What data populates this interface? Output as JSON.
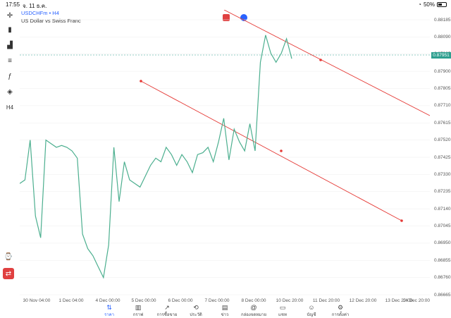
{
  "status": {
    "time": "17:55",
    "date": "จ. 11 ธ.ค.",
    "battery": "50%"
  },
  "symbol": {
    "name": "USDCHFm • H4",
    "description": "US Dollar vs Swiss Franc"
  },
  "price_axis": [
    "0.88185",
    "0.88090",
    "0.87995",
    "0.87900",
    "0.87805",
    "0.87710",
    "0.87615",
    "0.87520",
    "0.87425",
    "0.87330",
    "0.87235",
    "0.87140",
    "0.87045",
    "0.86950",
    "0.86855",
    "0.86760",
    "0.86665"
  ],
  "current_price": "0.87951",
  "time_axis": [
    "30 Nov 04:00",
    "1 Dec 04:00",
    "4 Dec 00:00",
    "5 Dec 00:00",
    "6 Dec 00:00",
    "7 Dec 00:00",
    "8 Dec 00:00",
    "10 Dec 20:00",
    "11 Dec 20:00",
    "12 Dec 20:00",
    "13 Dec 20:00",
    "14 Dec 20:00"
  ],
  "nav": [
    {
      "label": "ราคา",
      "icon": "quotes-icon",
      "glyph": "⇅",
      "active": true
    },
    {
      "label": "กราฟ",
      "icon": "chart-icon",
      "glyph": "▥",
      "active": false
    },
    {
      "label": "การซื้อขาย",
      "icon": "trade-icon",
      "glyph": "↗",
      "active": false
    },
    {
      "label": "ประวัติ",
      "icon": "history-icon",
      "glyph": "⟲",
      "active": false
    },
    {
      "label": "ข่าว",
      "icon": "news-icon",
      "glyph": "▤",
      "active": false
    },
    {
      "label": "กล่องจดหมาย",
      "icon": "mailbox-icon",
      "glyph": "@",
      "active": false
    },
    {
      "label": "แชท",
      "icon": "chat-icon",
      "glyph": "▭",
      "active": false
    },
    {
      "label": "บัญชี",
      "icon": "account-icon",
      "glyph": "☺",
      "active": false
    },
    {
      "label": "การตั้งค่า",
      "icon": "settings-icon",
      "glyph": "⚙",
      "active": false
    }
  ],
  "toolbar": [
    {
      "icon": "crosshair-icon",
      "glyph": "✛"
    },
    {
      "icon": "candles-icon",
      "glyph": "▮"
    },
    {
      "icon": "indicators-icon",
      "glyph": "▟"
    },
    {
      "icon": "objects-icon",
      "glyph": "≡"
    },
    {
      "icon": "function-icon",
      "glyph": "ƒ"
    },
    {
      "icon": "shapes-icon",
      "glyph": "◈"
    },
    {
      "icon": "timeframe-icon",
      "glyph": "H4"
    }
  ],
  "chart_data": {
    "type": "line",
    "series": [
      {
        "values": [
          0.8728,
          0.873,
          0.8752,
          0.871,
          0.8698,
          0.8752,
          0.875,
          0.8748,
          0.8749,
          0.8748,
          0.8746,
          0.8742,
          0.87,
          0.8692,
          0.8688,
          0.8682,
          0.8676,
          0.8694,
          0.8748,
          0.8718,
          0.874,
          0.873,
          0.8728,
          0.8726,
          0.8732,
          0.8738,
          0.8742,
          0.874,
          0.8748,
          0.8744,
          0.8738,
          0.8744,
          0.874,
          0.8734,
          0.8744,
          0.8745,
          0.8748,
          0.874,
          0.8751,
          0.8764,
          0.8741,
          0.8758,
          0.8751,
          0.8746,
          0.8761,
          0.8746,
          0.8795,
          0.881,
          0.88,
          0.8795,
          0.88,
          0.8808,
          0.8797
        ]
      }
    ],
    "ylim": [
      0.86665,
      0.88185
    ],
    "color": "#4caf8f"
  }
}
